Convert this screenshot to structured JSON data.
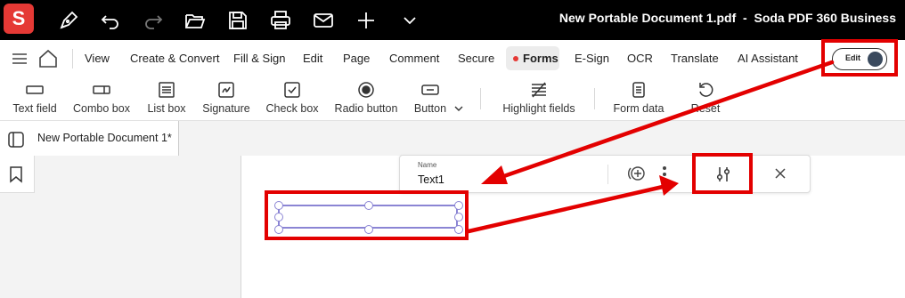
{
  "app": {
    "logo_letter": "S",
    "title": "New Portable Document 1.pdf  -  Soda PDF 360 Business"
  },
  "titlebar_icons": [
    "pen-icon",
    "undo-icon",
    "redo-icon",
    "open-folder-icon",
    "save-icon",
    "print-icon",
    "mail-icon",
    "plus-icon",
    "chevron-down-icon"
  ],
  "menu": {
    "items": [
      "View",
      "Create & Convert",
      "Fill & Sign",
      "Edit",
      "Page",
      "Comment",
      "Secure",
      "Forms",
      "E-Sign",
      "OCR",
      "Translate",
      "AI Assistant"
    ],
    "active": "Forms",
    "edit_toggle_label": "Edit"
  },
  "toolbar": {
    "tools": [
      "Text field",
      "Combo box",
      "List box",
      "Signature",
      "Check box",
      "Radio button",
      "Button",
      "Highlight fields",
      "Form data",
      "Reset"
    ]
  },
  "document": {
    "tab_label": "New Portable Document 1*"
  },
  "field_popup": {
    "name_caption": "Name",
    "name_value": "Text1"
  },
  "colors": {
    "accent_red": "#e30000",
    "forms_dot": "#e53935",
    "field_border": "#8b85d4",
    "titlebar_bg": "#000000"
  }
}
